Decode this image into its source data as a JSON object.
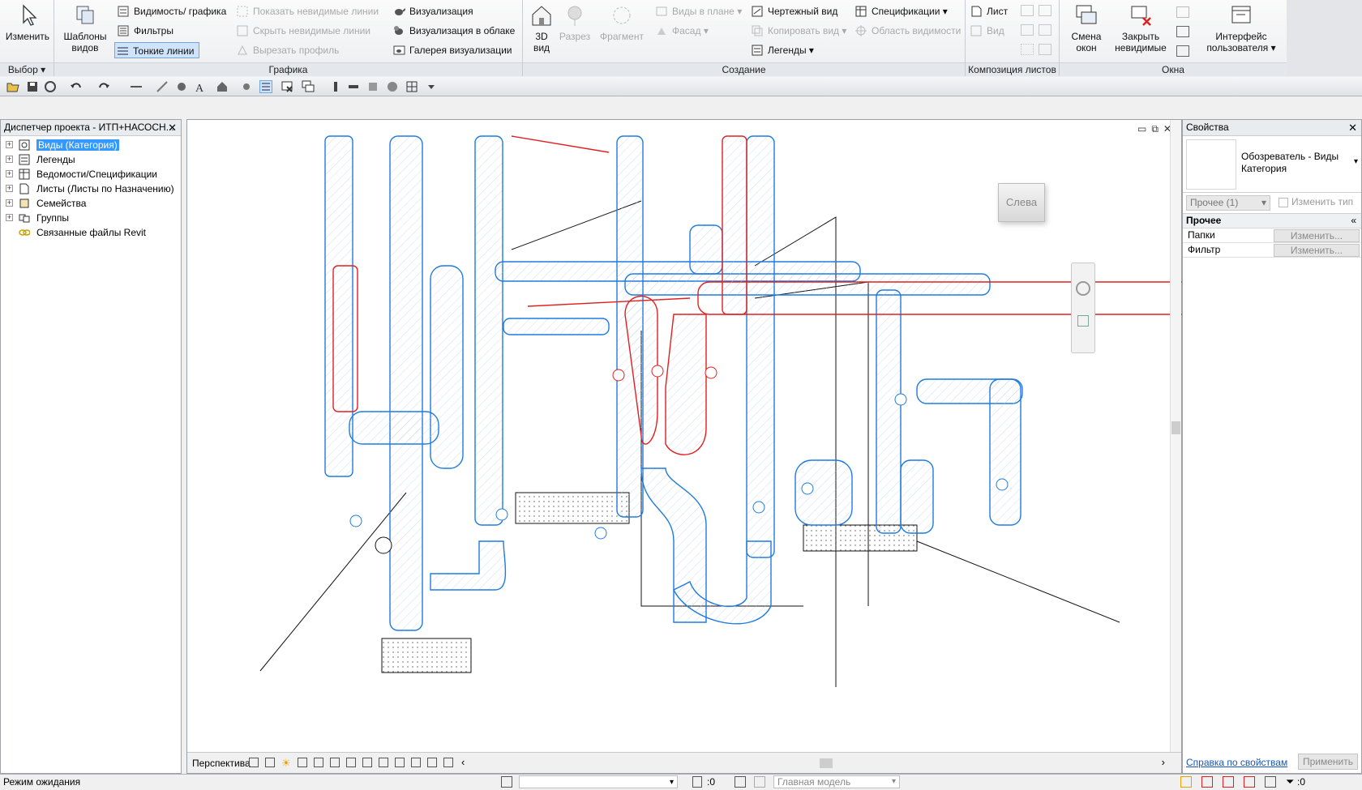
{
  "ribbon": {
    "modify": {
      "label": "Изменить",
      "group": "Выбор"
    },
    "graphics": {
      "title": "Графика",
      "templates": "Шаблоны видов",
      "visibility": "Видимость/ графика",
      "filters": "Фильтры",
      "thin_lines": "Тонкие линии",
      "show_hidden": "Показать невидимые линии",
      "hide_hidden": "Скрыть невидимые линии",
      "cut_profile": "Вырезать профиль",
      "render": "Визуализация",
      "render_cloud": "Визуализация в облаке",
      "render_gallery": "Галерея визуализации"
    },
    "create": {
      "title": "Создание",
      "view3d": "3D вид",
      "section": "Разрез",
      "callout": "Фрагмент",
      "plan_views": "Виды в плане",
      "elevation": "Фасад",
      "drafting": "Чертежный вид",
      "duplicate": "Копировать вид",
      "legends": "Легенды",
      "schedules": "Спецификации",
      "scope_box": "Область видимости"
    },
    "sheet": {
      "title": "Композиция листов",
      "sheet": "Лист",
      "view": "Вид"
    },
    "windows": {
      "title": "Окна",
      "switch": "Смена окон",
      "close_hidden": "Закрыть невидимые",
      "ui": "Интерфейс пользователя"
    }
  },
  "browser": {
    "title": "Диспетчер проекта - ИТП+НАСОСН...",
    "items": [
      "Виды (Категория)",
      "Легенды",
      "Ведомости/Спецификации",
      "Листы (Листы по Назначению)",
      "Семейства",
      "Группы",
      "Связанные файлы Revit"
    ]
  },
  "viewport": {
    "viewcube_label": "Слева",
    "view_mode": "Перспектива"
  },
  "properties": {
    "title": "Свойства",
    "type_name": "Обозреватель - Виды Категория",
    "instance_filter": "Прочее (1)",
    "edit_type": "Изменить тип",
    "section": "Прочее",
    "rows": [
      {
        "name": "Папки",
        "value": "Изменить..."
      },
      {
        "name": "Фильтр",
        "value": "Изменить..."
      }
    ],
    "help": "Справка по свойствам",
    "apply": "Применить"
  },
  "status": {
    "text": "Режим ожидания",
    "sel_count": ":0",
    "model": "Главная модель",
    "filter_count": ":0"
  },
  "colors": {
    "accent": "#3399ff",
    "pipe_blue": "#1e7be0",
    "pipe_red": "#e02020"
  }
}
